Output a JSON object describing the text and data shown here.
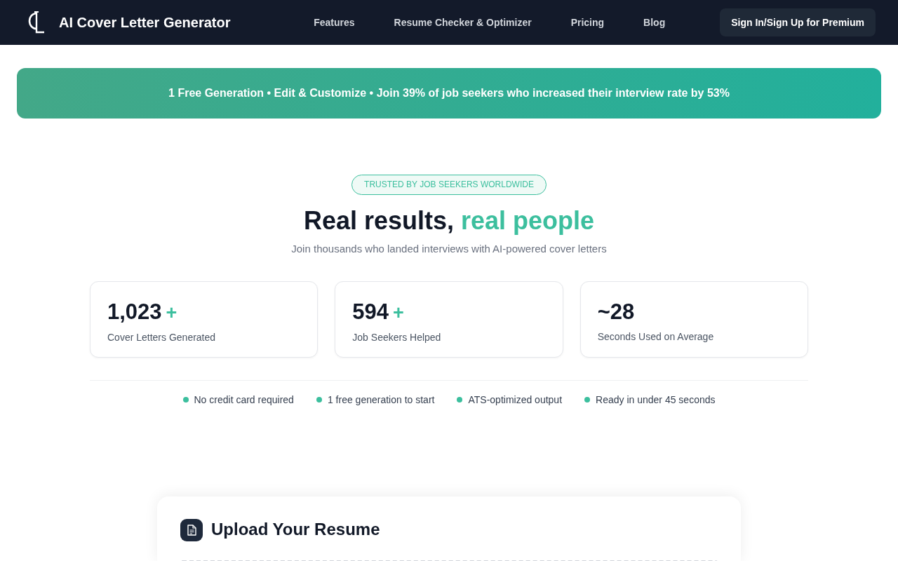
{
  "navbar": {
    "brand": "AI Cover Letter Generator",
    "links": [
      {
        "label": "Features"
      },
      {
        "label": "Resume Checker & Optimizer"
      },
      {
        "label": "Pricing"
      },
      {
        "label": "Blog"
      }
    ],
    "cta": "Sign In/Sign Up for Premium"
  },
  "banner": {
    "text": "1 Free Generation • Edit & Customize • Join 39% of job seekers who increased their interview rate by 53%"
  },
  "hero": {
    "badge": "TRUSTED BY JOB SEEKERS WORLDWIDE",
    "title": "Real results,",
    "title_highlight": "real people",
    "subtitle": "Join thousands who landed interviews with AI-powered cover letters"
  },
  "stats": [
    {
      "value": "1,023",
      "suffix": "+",
      "label": "Cover Letters Generated"
    },
    {
      "value": "594",
      "suffix": "+",
      "label": "Job Seekers Helped"
    },
    {
      "value": "~28",
      "label": "Seconds Used on Average"
    }
  ],
  "features": [
    {
      "text": "No credit card required"
    },
    {
      "text": "1 free generation to start"
    },
    {
      "text": "ATS-optimized output"
    },
    {
      "text": "Ready in under 45 seconds"
    }
  ],
  "upload": {
    "title": "Upload Your Resume"
  }
}
